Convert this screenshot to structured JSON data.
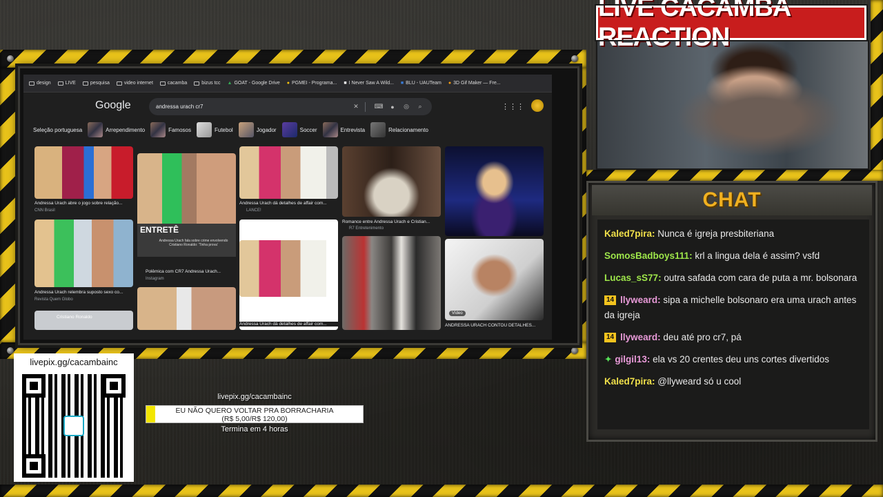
{
  "overlay": {
    "cam_title": "LIVE  CACAMBA REACTION",
    "chat_title": "CHAT",
    "livepix_url": "livepix.gg/cacambainc",
    "qr_url": "livepix.gg/cacambainc",
    "goal_line1": "EU NÃO QUERO VOLTAR PRA BORRACHARIA",
    "goal_line2": "(R$ 5,00/R$ 120,00)",
    "goal_progress": 0.042,
    "ends": "Termina em 4 horas"
  },
  "browser": {
    "bookmarks": [
      "design",
      "LIVE",
      "pesquisa",
      "video internet",
      "cacamba",
      "bizus tcc",
      "GOAT - Google Drive",
      "PGMEI - Programa...",
      "I Never Saw A Wild...",
      "BLU - UAUTeam",
      "3D Gif Maker — Fre..."
    ],
    "logo": "Google",
    "query": "andressa urach cr7",
    "chips": [
      "Seleção portuguesa",
      "Arrependimento",
      "Famosos",
      "Futebol",
      "Jogador",
      "Soccer",
      "Entrevista",
      "Relacionamento"
    ],
    "results": [
      {
        "caption": "Andressa Urach abre o jogo sobre relação...",
        "source": "CNN Brasil"
      },
      {
        "caption": "Andressa Urach relembra suposto sexo co...",
        "source": "Revista Quem Globo"
      },
      {
        "caption": "Cristiano Ronaldo",
        "source": ""
      },
      {
        "caption": "Polêmica com CR7 Andressa Urach...",
        "source": "Instagram",
        "overlay_title": "ENTRETÊ",
        "overlay_sub": "Andressa Urach fala sobre crime envolvendo Cristiano Ronaldo: 'Tinha prova'"
      },
      {
        "caption": "Andressa Urach dá detalhes de affair com...",
        "source": "LANCE!"
      },
      {
        "caption": "Andressa Urach dá detalhes de affair com...",
        "source": ""
      },
      {
        "caption": "Romance entre Andressa Urach e Cristian...",
        "source": "R7 Entretenimento"
      },
      {
        "caption": "ANDRESSA URACH CONTOU DETALHES...",
        "source": "",
        "badge": "Vídeo"
      }
    ]
  },
  "chat": {
    "messages": [
      {
        "user": "Kaled7pira",
        "color": "#f0e04a",
        "badge": "",
        "text": " Nunca é igreja presbiteriana"
      },
      {
        "user": "SomosBadboys111",
        "color": "#9ee64a",
        "badge": "",
        "text": " krl a lingua dela é assim? vsfd"
      },
      {
        "user": "Lucas_sS77",
        "color": "#9ee64a",
        "badge": "",
        "text": " outra safada com cara de puta a mr. bolsonara"
      },
      {
        "user": "llyweard",
        "color": "#e89ad8",
        "badge": "14",
        "text": " sipa a michelle bolsonaro era uma urach antes da igreja"
      },
      {
        "user": "llyweard",
        "color": "#e89ad8",
        "badge": "14",
        "text": " deu até pro cr7, pá"
      },
      {
        "user": "gilgil13",
        "color": "#e89ad8",
        "badge": "✦",
        "text": " ela vs 20 crentes deu uns cortes divertidos"
      },
      {
        "user": "Kaled7pira",
        "color": "#f0e04a",
        "badge": "",
        "text": " @llyweard só u cool"
      }
    ]
  }
}
